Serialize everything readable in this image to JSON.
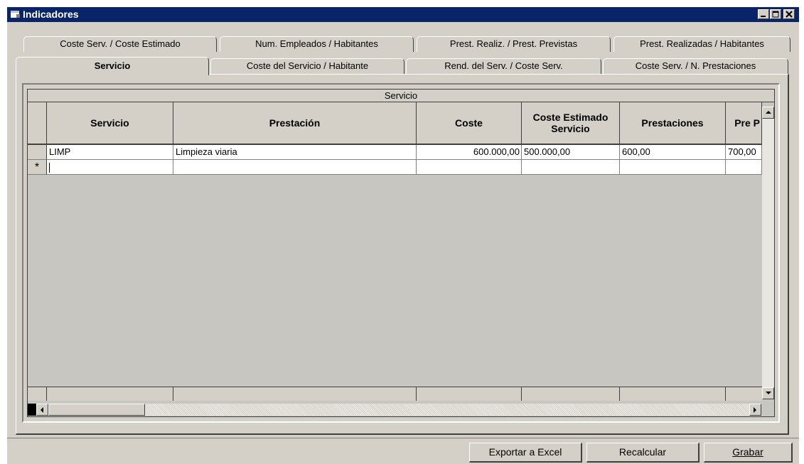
{
  "window": {
    "title": "Indicadores"
  },
  "tabs_back": [
    "Coste Serv. / Coste Estimado",
    "Num. Empleados / Habitantes",
    "Prest. Realiz. / Prest. Previstas",
    "Prest. Realizadas / Habitantes"
  ],
  "tabs_front": [
    "Servicio",
    "Coste del Servicio / Habitante",
    "Rend. del Serv. / Coste Serv.",
    "Coste Serv. / N. Prestaciones"
  ],
  "active_tab": "Servicio",
  "grid": {
    "caption": "Servicio",
    "columns": [
      "Servicio",
      "Prestación",
      "Coste",
      "Coste Estimado Servicio",
      "Prestaciones",
      "Pre P"
    ],
    "rows": [
      [
        "LIMP",
        "Limpieza viaria",
        "600.000,00",
        "500.000,00",
        "600,00",
        "700,00"
      ]
    ],
    "new_row_marker": "*"
  },
  "buttons": {
    "export": "Exportar a Excel",
    "recalc": "Recalcular",
    "save": "Grabar"
  },
  "colors": {
    "titlebar": "#0a246a",
    "face": "#d4d0c8",
    "grid_empty": "#c8c6c0"
  }
}
